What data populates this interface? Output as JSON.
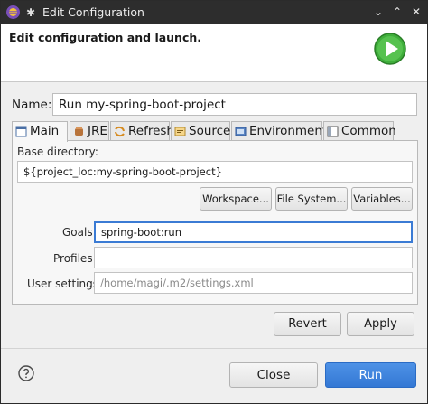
{
  "window": {
    "title": "Edit Configuration"
  },
  "header": {
    "title": "Edit configuration and launch."
  },
  "name": {
    "label": "Name:",
    "value": "Run my-spring-boot-project"
  },
  "tabs": [
    {
      "label": "Main",
      "icon": "main-tab-icon",
      "active": true
    },
    {
      "label": "JRE",
      "icon": "jre-icon",
      "active": false
    },
    {
      "label": "Refresh",
      "icon": "refresh-icon",
      "active": false
    },
    {
      "label": "Source",
      "icon": "source-icon",
      "active": false
    },
    {
      "label": "Environment",
      "icon": "environment-icon",
      "active": false
    },
    {
      "label": "Common",
      "icon": "common-icon",
      "active": false
    }
  ],
  "main": {
    "base_directory": {
      "label": "Base directory:",
      "value": "${project_loc:my-spring-boot-project}"
    },
    "buttons": {
      "workspace": "Workspace...",
      "file_system": "File System...",
      "variables": "Variables..."
    },
    "goals": {
      "label": "Goals:",
      "value": "spring-boot:run"
    },
    "profiles": {
      "label": "Profiles:",
      "value": ""
    },
    "user_settings": {
      "label": "User settings:",
      "value": "",
      "placeholder": "/home/magi/.m2/settings.xml"
    }
  },
  "actions": {
    "revert": "Revert",
    "apply": "Apply",
    "close": "Close",
    "run": "Run"
  },
  "colors": {
    "accent": "#3478d4",
    "titlebar": "#2d2d2d",
    "run_icon": "#3fae3b"
  }
}
